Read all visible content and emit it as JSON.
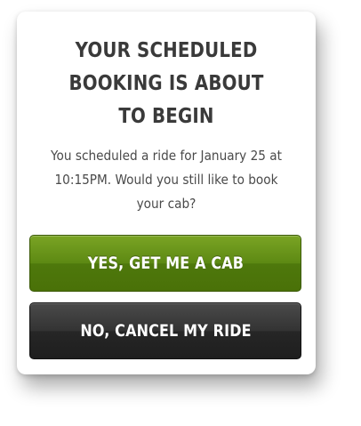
{
  "dialog": {
    "title_lines": [
      "YOUR SCHEDULED",
      "BOOKING IS ABOUT",
      "TO BEGIN"
    ],
    "message": "You scheduled a ride for January 25 at 10:15PM. Would you still like to book your cab?",
    "confirm_label": "YES, GET ME A CAB",
    "cancel_label": "NO, CANCEL MY RIDE"
  },
  "colors": {
    "confirm_button": "#5d8913",
    "cancel_button": "#2e2e2e",
    "title_text": "#3a3a3a",
    "body_text": "#4a4a4a"
  }
}
